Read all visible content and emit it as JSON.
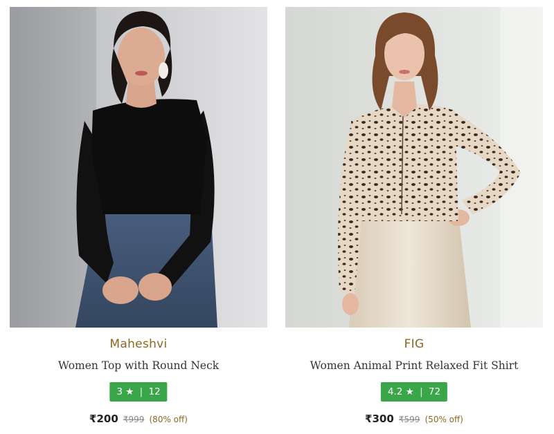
{
  "products": [
    {
      "brand": "Maheshvi",
      "title": "Women Top with Round Neck",
      "rating": "3",
      "star": "★",
      "reviews": "12",
      "price": "₹200",
      "mrp": "₹999",
      "discount": "(80% off)",
      "image": "product-photo-black-top"
    },
    {
      "brand": "FIG",
      "title": "Women Animal Print Relaxed Fit Shirt",
      "rating": "4.2",
      "star": "★",
      "reviews": "72",
      "price": "₹300",
      "mrp": "₹599",
      "discount": "(50% off)",
      "image": "product-photo-animal-print-shirt"
    }
  ],
  "colors": {
    "brand": "#8a6a1e",
    "rating_bg": "#3aa549"
  }
}
